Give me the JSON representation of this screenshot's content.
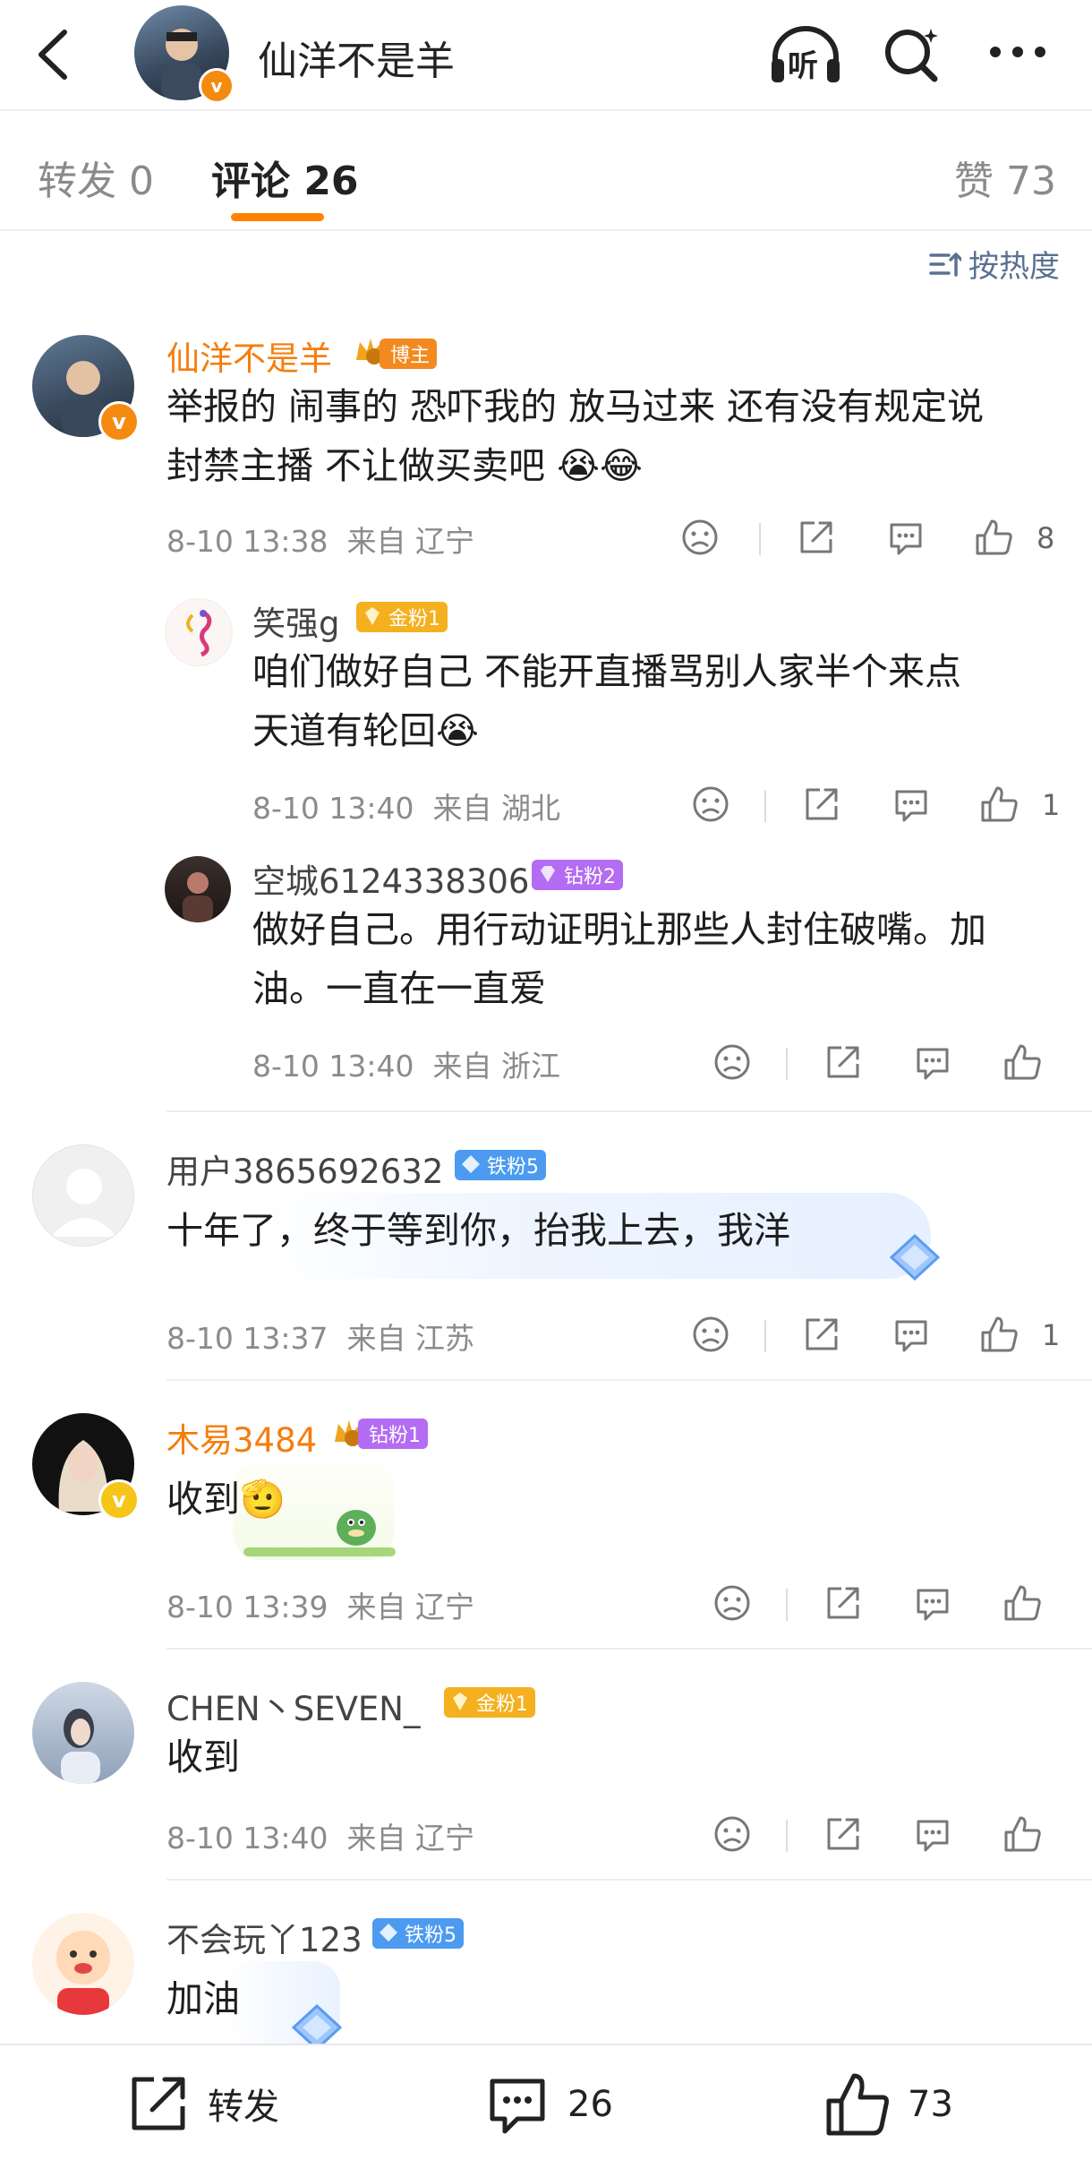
{
  "header": {
    "title": "仙洋不是羊",
    "listen_label": "听"
  },
  "tabs": {
    "repost": "转发 0",
    "comments": "评论 26",
    "likes": "赞 73"
  },
  "sort_label": "按热度",
  "comments": [
    {
      "user": "仙洋不是羊",
      "badge": "博主",
      "text_lines": [
        "举报的 闹事的 恐吓我的 放马过来 还有没有规定说",
        "封禁主播 不让做买卖吧 😭😂"
      ],
      "time": "8-10 13:38",
      "location": "来自 辽宁",
      "like_count": "8"
    },
    {
      "user": "笑强g",
      "badge": "金粉1",
      "text_lines": [
        "咱们做好自己  不能开直播骂别人家半个来点",
        "天道有轮回😭"
      ],
      "time": "8-10 13:40",
      "location": "来自 湖北",
      "like_count": "1"
    },
    {
      "user": "空城6124338306",
      "badge": "钻粉2",
      "text_lines": [
        "做好自己。用行动证明让那些人封住破嘴。加",
        "油。一直在一直爱"
      ],
      "time": "8-10 13:40",
      "location": "来自 浙江",
      "like_count": ""
    },
    {
      "user": "用户3865692632",
      "badge": "铁粉5",
      "text_lines": [
        "十年了，终于等到你，抬我上去，我洋"
      ],
      "time": "8-10 13:37",
      "location": "来自 江苏",
      "like_count": "1"
    },
    {
      "user": "木易3484",
      "badge": "钻粉1",
      "text_lines": [
        "收到🫡"
      ],
      "time": "8-10 13:39",
      "location": "来自 辽宁",
      "like_count": ""
    },
    {
      "user": "CHEN丶SEVEN_",
      "badge": "金粉1",
      "text_lines": [
        "收到"
      ],
      "time": "8-10 13:40",
      "location": "来自 辽宁",
      "like_count": ""
    },
    {
      "user": "不会玩丫123",
      "badge": "铁粉5",
      "text_lines": [
        "加油"
      ],
      "time": "",
      "location": "",
      "like_count": ""
    }
  ],
  "bottom_bar": {
    "repost": "转发",
    "comments": "26",
    "likes": "73"
  },
  "colors": {
    "accent": "#ff8200",
    "gold_badge": "#f5b020",
    "diamond_badge": "#b36cf2",
    "iron_badge": "#4c9bf0",
    "blogger_badge": "#f28a1f"
  }
}
